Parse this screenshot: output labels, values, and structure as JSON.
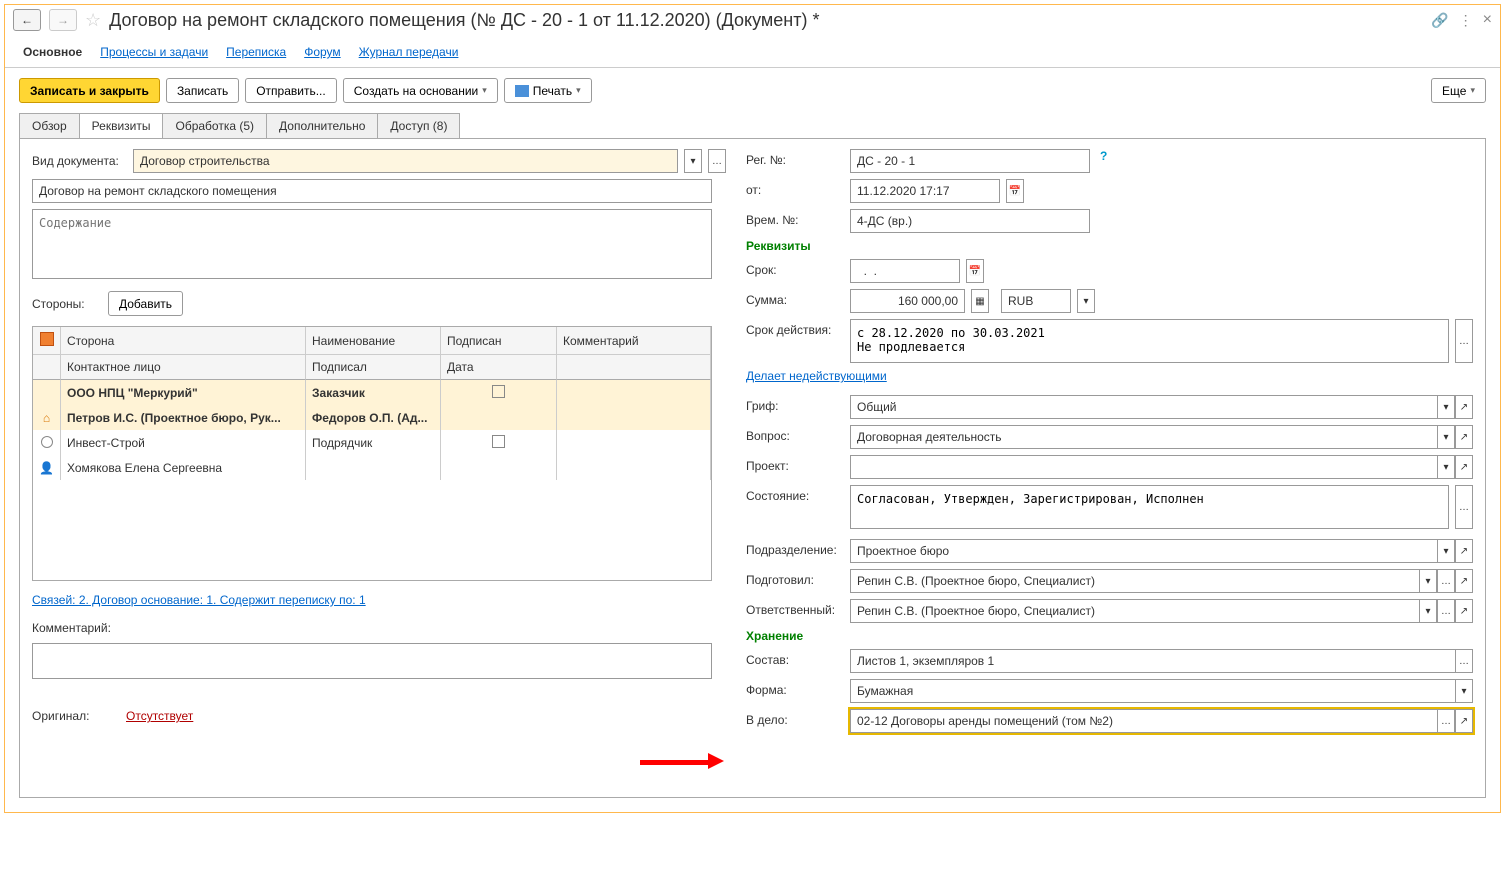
{
  "header": {
    "title": "Договор на ремонт складского помещения (№ ДС - 20 - 1 от 11.12.2020) (Документ) *"
  },
  "subnav": {
    "main": "Основное",
    "processes": "Процессы и задачи",
    "correspondence": "Переписка",
    "forum": "Форум",
    "transfer_log": "Журнал передачи"
  },
  "toolbar": {
    "save_close": "Записать и закрыть",
    "save": "Записать",
    "send": "Отправить...",
    "create_based": "Создать на основании",
    "print": "Печать",
    "more": "Еще"
  },
  "tabs": {
    "overview": "Обзор",
    "requisites": "Реквизиты",
    "processing": "Обработка (5)",
    "additional": "Дополнительно",
    "access": "Доступ (8)"
  },
  "left": {
    "doc_kind_label": "Вид документа:",
    "doc_kind": "Договор строительства",
    "name": "Договор на ремонт складского помещения",
    "content_placeholder": "Содержание",
    "parties_label": "Стороны:",
    "add": "Добавить",
    "th_side": "Сторона",
    "th_name": "Наименование",
    "th_signed": "Подписан",
    "th_comment": "Комментарий",
    "th_contact": "Контактное лицо",
    "th_signer": "Подписал",
    "th_date": "Дата",
    "r1_side": "ООО НПЦ \"Меркурий\"",
    "r1_role": "Заказчик",
    "r2_side": "Петров И.С. (Проектное бюро, Рук...",
    "r2_role": "Федоров О.П. (Ад...",
    "r3_side": "Инвест-Строй",
    "r3_role": "Подрядчик",
    "r4_side": "Хомякова Елена Сергеевна",
    "links": "Связей: 2. Договор основание: 1. Содержит переписку по: 1",
    "comment_label": "Комментарий:",
    "original_label": "Оригинал:",
    "original_value": "Отсутствует"
  },
  "right": {
    "reg_no_label": "Рег. №:",
    "reg_no": "ДС - 20 - 1",
    "from_label": "от:",
    "from": "11.12.2020 17:17",
    "temp_no_label": "Врем. №:",
    "temp_no": "4-ДС (вр.)",
    "requisites_section": "Реквизиты",
    "term_label": "Срок:",
    "term": "  .  .    ",
    "sum_label": "Сумма:",
    "sum": "160 000,00",
    "currency": "RUB",
    "validity_label": "Срок действия:",
    "validity": "с 28.12.2020 по 30.03.2021\nНе продлевается",
    "invalidates_link": "Делает недействующими",
    "grif_label": "Гриф:",
    "grif": "Общий",
    "question_label": "Вопрос:",
    "question": "Договорная деятельность",
    "project_label": "Проект:",
    "state_label": "Состояние:",
    "state": "Согласован, Утвержден, Зарегистрирован, Исполнен",
    "department_label": "Подразделение:",
    "department": "Проектное бюро",
    "prepared_label": "Подготовил:",
    "prepared": "Репин С.В. (Проектное бюро, Специалист)",
    "responsible_label": "Ответственный:",
    "responsible": "Репин С.В. (Проектное бюро, Специалист)",
    "storage_section": "Хранение",
    "composition_label": "Состав:",
    "composition": "Листов 1, экземпляров 1",
    "form_label": "Форма:",
    "form": "Бумажная",
    "to_case_label": "В дело:",
    "to_case": "02-12 Договоры аренды помещений (том №2)"
  }
}
